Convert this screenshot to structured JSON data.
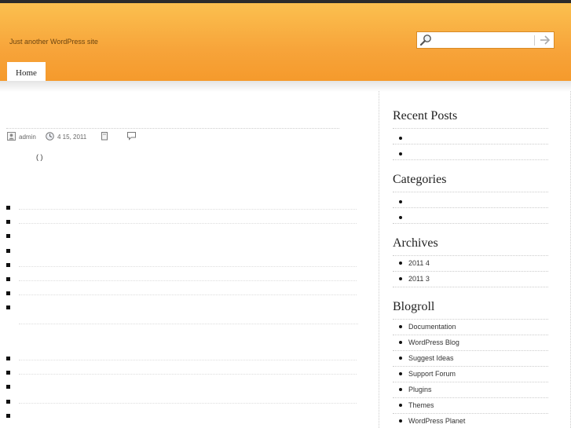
{
  "header": {
    "tagline": "Just another WordPress site",
    "search": {
      "placeholder": "",
      "value": ""
    },
    "nav": {
      "home_label": "Home"
    }
  },
  "post": {
    "meta": {
      "author": "admin",
      "date": "4  15, 2011"
    },
    "paren": "( )"
  },
  "sidebar": {
    "recent_posts": {
      "title": "Recent Posts"
    },
    "categories": {
      "title": "Categories"
    },
    "archives": {
      "title": "Archives",
      "items": [
        "2011 4",
        "2011 3"
      ]
    },
    "blogroll": {
      "title": "Blogroll",
      "items": [
        "Documentation",
        "WordPress Blog",
        "Suggest Ideas",
        "Support Forum",
        "Plugins",
        "Themes",
        "WordPress Planet"
      ]
    }
  }
}
